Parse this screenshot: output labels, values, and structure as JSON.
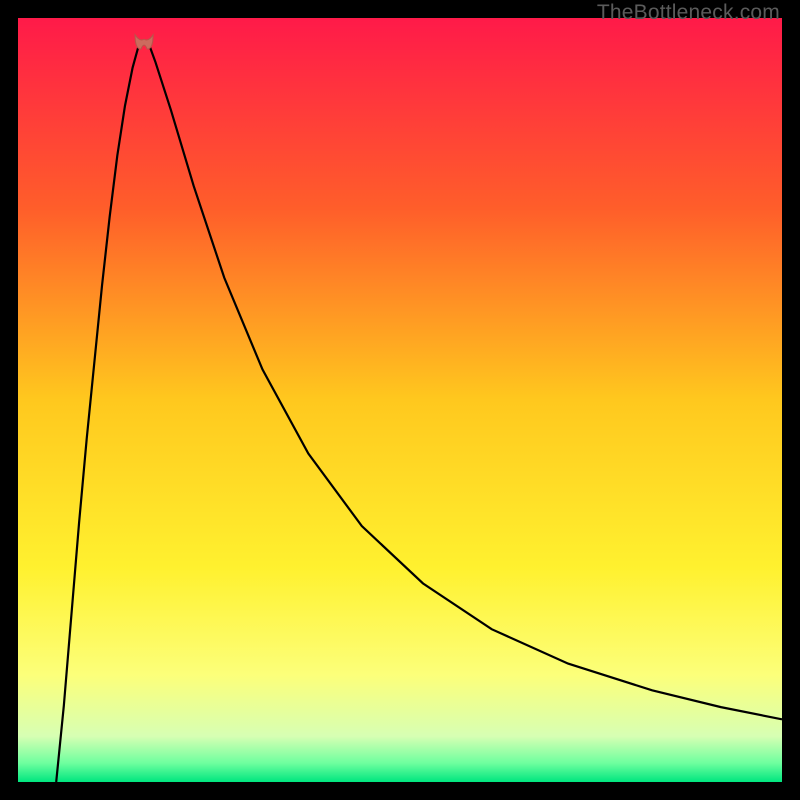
{
  "watermark": "TheBottleneck.com",
  "chart_data": {
    "type": "line",
    "title": "",
    "xlabel": "",
    "ylabel": "",
    "xlim": [
      0,
      100
    ],
    "ylim": [
      0,
      100
    ],
    "gradient_stops": [
      {
        "offset": 0.0,
        "color": "#ff1a49"
      },
      {
        "offset": 0.25,
        "color": "#ff5e2a"
      },
      {
        "offset": 0.5,
        "color": "#ffc81e"
      },
      {
        "offset": 0.72,
        "color": "#fff12f"
      },
      {
        "offset": 0.86,
        "color": "#fcff7a"
      },
      {
        "offset": 0.94,
        "color": "#d7ffb3"
      },
      {
        "offset": 0.975,
        "color": "#6fff9f"
      },
      {
        "offset": 1.0,
        "color": "#00e67f"
      }
    ],
    "green_band": {
      "y_start": 97.5,
      "y_end": 100
    },
    "curve_minimum": {
      "x": 16.5,
      "y": 97.0
    },
    "marker": {
      "x": 16.5,
      "y": 97.1,
      "shape": "blob",
      "color": "#cc6b5e"
    },
    "series": [
      {
        "name": "left-branch",
        "x": [
          5.0,
          6.0,
          7.0,
          8.0,
          9.0,
          10.0,
          11.0,
          12.0,
          13.0,
          14.0,
          15.0,
          15.8
        ],
        "y": [
          0.0,
          10.0,
          22.0,
          34.0,
          45.0,
          55.0,
          65.0,
          74.0,
          82.0,
          88.5,
          93.5,
          96.4
        ]
      },
      {
        "name": "right-branch",
        "x": [
          17.2,
          18.0,
          20.0,
          23.0,
          27.0,
          32.0,
          38.0,
          45.0,
          53.0,
          62.0,
          72.0,
          83.0,
          92.0,
          100.0
        ],
        "y": [
          96.4,
          94.2,
          88.0,
          78.0,
          66.0,
          54.0,
          43.0,
          33.5,
          26.0,
          20.0,
          15.5,
          12.0,
          9.8,
          8.2
        ]
      }
    ]
  }
}
